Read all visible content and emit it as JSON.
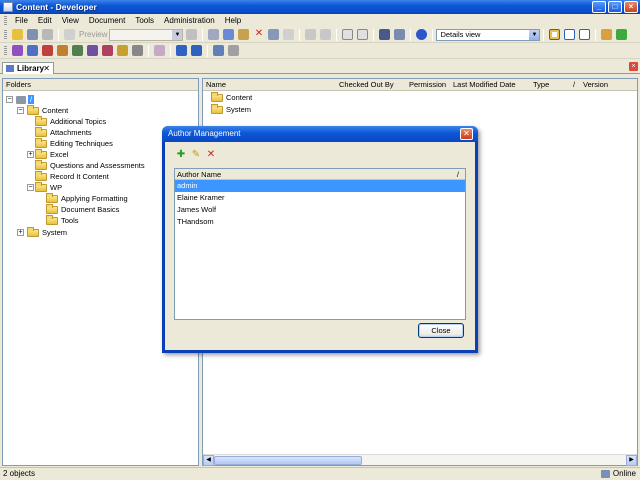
{
  "window": {
    "title": "Content - Developer"
  },
  "menu": [
    "File",
    "Edit",
    "View",
    "Document",
    "Tools",
    "Administration",
    "Help"
  ],
  "toolbar": {
    "preview_label": "Preview",
    "view_mode": "Details view"
  },
  "library_tab": {
    "label": "Library",
    "close": "✕"
  },
  "left_panel": {
    "header": "Folders",
    "tree": [
      {
        "label": "/",
        "level": 0
      },
      {
        "label": "Content",
        "level": 1
      },
      {
        "label": "Additional Topics",
        "level": 2
      },
      {
        "label": "Attachments",
        "level": 2
      },
      {
        "label": "Editing Techniques",
        "level": 2
      },
      {
        "label": "Excel",
        "level": 2
      },
      {
        "label": "Questions and Assessments",
        "level": 2
      },
      {
        "label": "Record It Content",
        "level": 2
      },
      {
        "label": "WP",
        "level": 2
      },
      {
        "label": "Applying Formatting",
        "level": 3
      },
      {
        "label": "Document Basics",
        "level": 3
      },
      {
        "label": "Tools",
        "level": 3
      },
      {
        "label": "System",
        "level": 1
      }
    ]
  },
  "right_panel": {
    "columns": [
      "Name",
      "Checked Out By",
      "Permission",
      "Last Modified Date",
      "Type",
      "/",
      "Version"
    ],
    "rows": [
      "Content",
      "System"
    ]
  },
  "status": {
    "count": "2 objects",
    "connection": "Online"
  },
  "dialog": {
    "title": "Author Management",
    "close_glyph": "✕",
    "tools": {
      "add": "✚",
      "edit": "✎",
      "delete": "✕"
    },
    "list_header": "Author Name",
    "sort_glyph": "/",
    "authors": [
      "admin",
      "Elaine Kramer",
      "James Wolf",
      "THandsom"
    ],
    "selected_index": 0,
    "close_label": "Close"
  },
  "colors": {
    "accent": "#0c56d8",
    "selection": "#3d95ff"
  }
}
